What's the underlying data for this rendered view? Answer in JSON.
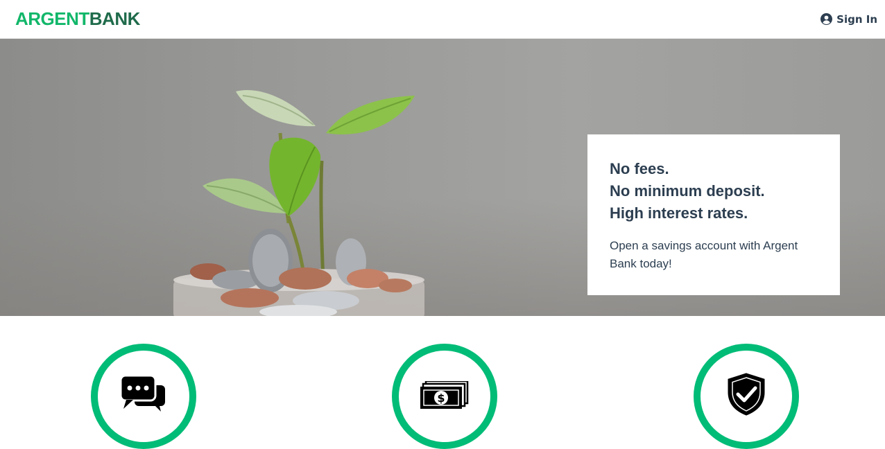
{
  "header": {
    "logo_part1": "ARGENT",
    "logo_part2": "BANK",
    "sign_in_label": "Sign In",
    "sign_in_icon": "user-circle-icon"
  },
  "hero": {
    "subtitles": [
      "No fees.",
      "No minimum deposit.",
      "High interest rates."
    ],
    "text": "Open a savings account with Argent Bank today!"
  },
  "features": [
    {
      "icon": "chat-icon"
    },
    {
      "icon": "money-icon"
    },
    {
      "icon": "security-icon"
    }
  ],
  "colors": {
    "brand_green": "#00bc77",
    "logo_dark_green": "#1f6b4b",
    "text_dark": "#2c3e50"
  }
}
